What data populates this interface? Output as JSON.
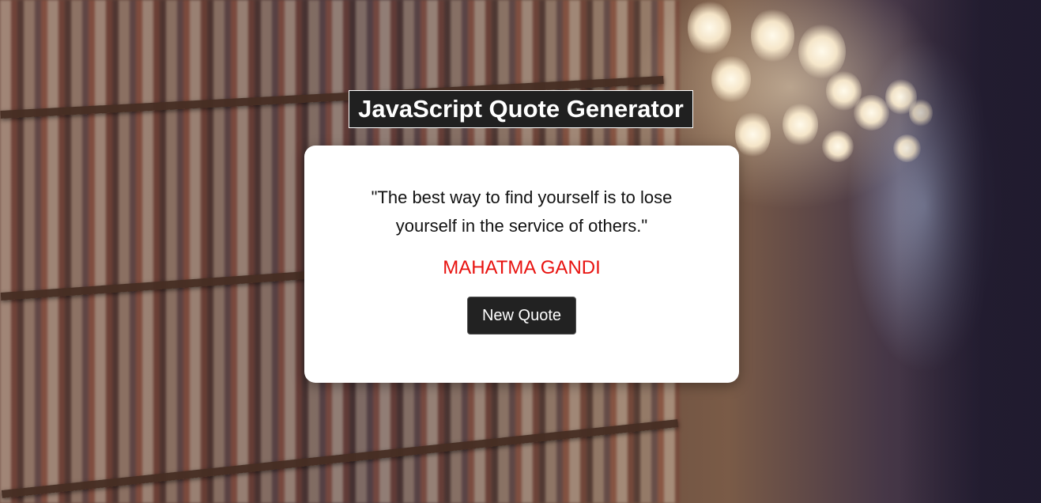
{
  "header": {
    "title": "JavaScript Quote Generator"
  },
  "quote": {
    "text": "\"The best way to find yourself is to lose yourself in the service of others.\"",
    "author": "MAHATMA GANDI"
  },
  "actions": {
    "new_quote_label": "New Quote"
  },
  "colors": {
    "author": "#e8120f",
    "button_background": "#222222",
    "title_background": "#202020",
    "card_background": "#ffffff"
  },
  "background": {
    "description_icon": "library-background-image"
  }
}
